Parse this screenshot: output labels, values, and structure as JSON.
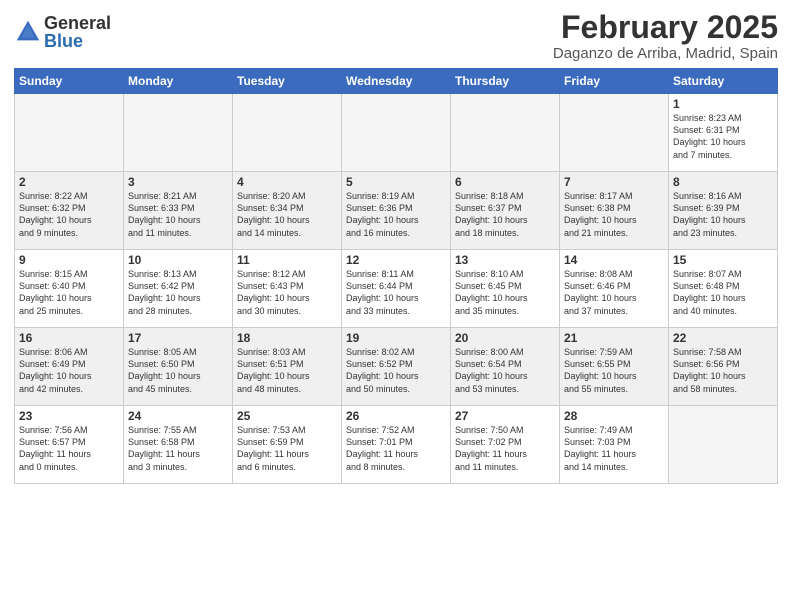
{
  "header": {
    "logo_general": "General",
    "logo_blue": "Blue",
    "month": "February 2025",
    "location": "Daganzo de Arriba, Madrid, Spain"
  },
  "days_of_week": [
    "Sunday",
    "Monday",
    "Tuesday",
    "Wednesday",
    "Thursday",
    "Friday",
    "Saturday"
  ],
  "weeks": [
    {
      "shade": false,
      "days": [
        {
          "num": "",
          "info": ""
        },
        {
          "num": "",
          "info": ""
        },
        {
          "num": "",
          "info": ""
        },
        {
          "num": "",
          "info": ""
        },
        {
          "num": "",
          "info": ""
        },
        {
          "num": "",
          "info": ""
        },
        {
          "num": "1",
          "info": "Sunrise: 8:23 AM\nSunset: 6:31 PM\nDaylight: 10 hours\nand 7 minutes."
        }
      ]
    },
    {
      "shade": true,
      "days": [
        {
          "num": "2",
          "info": "Sunrise: 8:22 AM\nSunset: 6:32 PM\nDaylight: 10 hours\nand 9 minutes."
        },
        {
          "num": "3",
          "info": "Sunrise: 8:21 AM\nSunset: 6:33 PM\nDaylight: 10 hours\nand 11 minutes."
        },
        {
          "num": "4",
          "info": "Sunrise: 8:20 AM\nSunset: 6:34 PM\nDaylight: 10 hours\nand 14 minutes."
        },
        {
          "num": "5",
          "info": "Sunrise: 8:19 AM\nSunset: 6:36 PM\nDaylight: 10 hours\nand 16 minutes."
        },
        {
          "num": "6",
          "info": "Sunrise: 8:18 AM\nSunset: 6:37 PM\nDaylight: 10 hours\nand 18 minutes."
        },
        {
          "num": "7",
          "info": "Sunrise: 8:17 AM\nSunset: 6:38 PM\nDaylight: 10 hours\nand 21 minutes."
        },
        {
          "num": "8",
          "info": "Sunrise: 8:16 AM\nSunset: 6:39 PM\nDaylight: 10 hours\nand 23 minutes."
        }
      ]
    },
    {
      "shade": false,
      "days": [
        {
          "num": "9",
          "info": "Sunrise: 8:15 AM\nSunset: 6:40 PM\nDaylight: 10 hours\nand 25 minutes."
        },
        {
          "num": "10",
          "info": "Sunrise: 8:13 AM\nSunset: 6:42 PM\nDaylight: 10 hours\nand 28 minutes."
        },
        {
          "num": "11",
          "info": "Sunrise: 8:12 AM\nSunset: 6:43 PM\nDaylight: 10 hours\nand 30 minutes."
        },
        {
          "num": "12",
          "info": "Sunrise: 8:11 AM\nSunset: 6:44 PM\nDaylight: 10 hours\nand 33 minutes."
        },
        {
          "num": "13",
          "info": "Sunrise: 8:10 AM\nSunset: 6:45 PM\nDaylight: 10 hours\nand 35 minutes."
        },
        {
          "num": "14",
          "info": "Sunrise: 8:08 AM\nSunset: 6:46 PM\nDaylight: 10 hours\nand 37 minutes."
        },
        {
          "num": "15",
          "info": "Sunrise: 8:07 AM\nSunset: 6:48 PM\nDaylight: 10 hours\nand 40 minutes."
        }
      ]
    },
    {
      "shade": true,
      "days": [
        {
          "num": "16",
          "info": "Sunrise: 8:06 AM\nSunset: 6:49 PM\nDaylight: 10 hours\nand 42 minutes."
        },
        {
          "num": "17",
          "info": "Sunrise: 8:05 AM\nSunset: 6:50 PM\nDaylight: 10 hours\nand 45 minutes."
        },
        {
          "num": "18",
          "info": "Sunrise: 8:03 AM\nSunset: 6:51 PM\nDaylight: 10 hours\nand 48 minutes."
        },
        {
          "num": "19",
          "info": "Sunrise: 8:02 AM\nSunset: 6:52 PM\nDaylight: 10 hours\nand 50 minutes."
        },
        {
          "num": "20",
          "info": "Sunrise: 8:00 AM\nSunset: 6:54 PM\nDaylight: 10 hours\nand 53 minutes."
        },
        {
          "num": "21",
          "info": "Sunrise: 7:59 AM\nSunset: 6:55 PM\nDaylight: 10 hours\nand 55 minutes."
        },
        {
          "num": "22",
          "info": "Sunrise: 7:58 AM\nSunset: 6:56 PM\nDaylight: 10 hours\nand 58 minutes."
        }
      ]
    },
    {
      "shade": false,
      "days": [
        {
          "num": "23",
          "info": "Sunrise: 7:56 AM\nSunset: 6:57 PM\nDaylight: 11 hours\nand 0 minutes."
        },
        {
          "num": "24",
          "info": "Sunrise: 7:55 AM\nSunset: 6:58 PM\nDaylight: 11 hours\nand 3 minutes."
        },
        {
          "num": "25",
          "info": "Sunrise: 7:53 AM\nSunset: 6:59 PM\nDaylight: 11 hours\nand 6 minutes."
        },
        {
          "num": "26",
          "info": "Sunrise: 7:52 AM\nSunset: 7:01 PM\nDaylight: 11 hours\nand 8 minutes."
        },
        {
          "num": "27",
          "info": "Sunrise: 7:50 AM\nSunset: 7:02 PM\nDaylight: 11 hours\nand 11 minutes."
        },
        {
          "num": "28",
          "info": "Sunrise: 7:49 AM\nSunset: 7:03 PM\nDaylight: 11 hours\nand 14 minutes."
        },
        {
          "num": "",
          "info": ""
        }
      ]
    }
  ]
}
